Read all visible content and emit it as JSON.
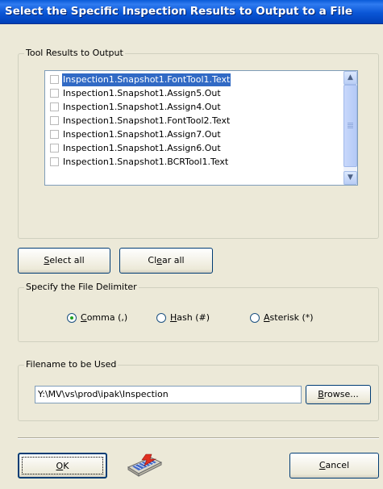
{
  "window": {
    "title": "Select the Specific Inspection Results to Output to a File"
  },
  "tool_results": {
    "legend": "Tool Results to Output",
    "items": [
      {
        "label": "Inspection1.Snapshot1.FontTool1.Text",
        "checked": false,
        "selected": true
      },
      {
        "label": "Inspection1.Snapshot1.Assign5.Out",
        "checked": false,
        "selected": false
      },
      {
        "label": "Inspection1.Snapshot1.Assign4.Out",
        "checked": false,
        "selected": false
      },
      {
        "label": "Inspection1.Snapshot1.FontTool2.Text",
        "checked": false,
        "selected": false
      },
      {
        "label": "Inspection1.Snapshot1.Assign7.Out",
        "checked": false,
        "selected": false
      },
      {
        "label": "Inspection1.Snapshot1.Assign6.Out",
        "checked": false,
        "selected": false
      },
      {
        "label": "Inspection1.Snapshot1.BCRTool1.Text",
        "checked": false,
        "selected": false
      }
    ]
  },
  "buttons": {
    "select_all": {
      "accel": "S",
      "rest": "elect all"
    },
    "clear_all": {
      "pre": "Cl",
      "accel": "e",
      "rest": "ar all"
    },
    "browse": {
      "accel": "B",
      "rest": "rowse..."
    },
    "ok": {
      "accel": "O",
      "rest": "K"
    },
    "cancel": {
      "accel": "C",
      "rest": "ancel"
    }
  },
  "delimiter": {
    "legend": "Specify the File Delimiter",
    "options": [
      {
        "pre": "",
        "accel": "C",
        "rest": "omma (,)",
        "checked": true
      },
      {
        "pre": "",
        "accel": "H",
        "rest": "ash (#)",
        "checked": false
      },
      {
        "pre": "",
        "accel": "A",
        "rest": "sterisk (*)",
        "checked": false
      }
    ]
  },
  "filename": {
    "legend": "Filename to be Used",
    "value": "Y:\\MV\\vs\\prod\\ipak\\Inspection"
  },
  "icons": {
    "keyboard": "keyboard-icon"
  },
  "colors": {
    "title_bar": "#0a56d6",
    "selection": "#316ac5",
    "radio_dot": "#21a121"
  }
}
